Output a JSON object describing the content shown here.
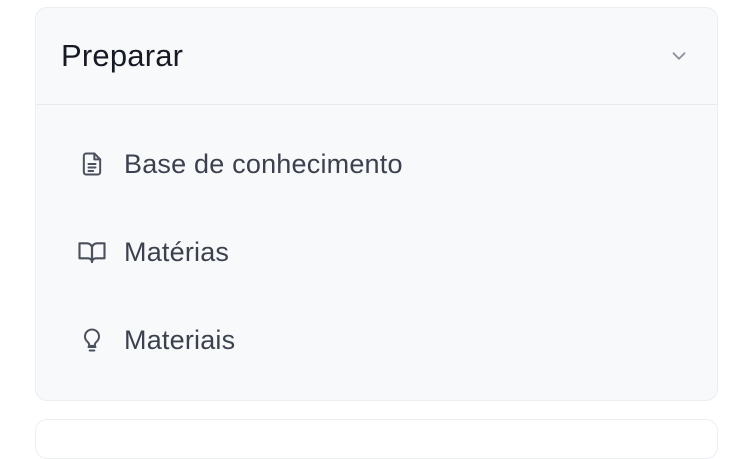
{
  "section": {
    "title": "Preparar",
    "expanded": true,
    "chevron_icon": "chevron-down-icon",
    "items": [
      {
        "label": "Base de conhecimento",
        "icon": "document-icon"
      },
      {
        "label": "Matérias",
        "icon": "book-open-icon"
      },
      {
        "label": "Materiais",
        "icon": "lightbulb-icon"
      }
    ]
  },
  "colors": {
    "panel_background": "#f8f9fb",
    "title_text": "#161a24",
    "item_text": "#3b414e",
    "icon": "#4a505c",
    "border": "#e8eaef"
  }
}
